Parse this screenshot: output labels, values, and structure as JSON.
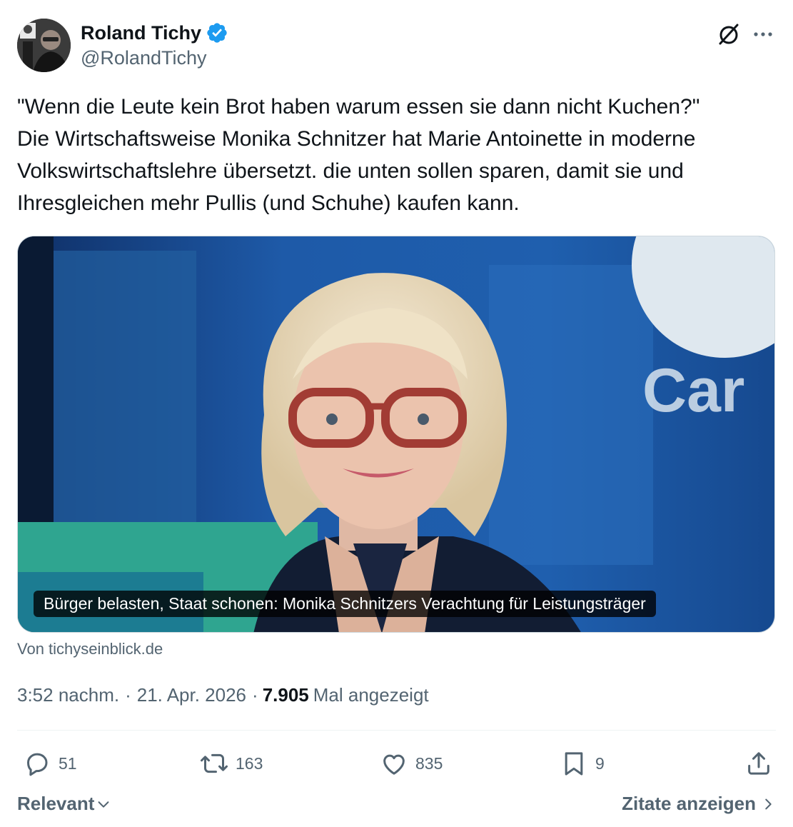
{
  "author": {
    "display_name": "Roland Tichy",
    "handle": "@RolandTichy",
    "verified": true
  },
  "tweet": {
    "text": "\"Wenn die Leute kein Brot haben warum essen sie dann nicht Kuchen?\"\nDie Wirtschaftsweise Monika Schnitzer hat Marie Antoinette in moderne Volkswirtschaftslehre übersetzt. die unten sollen sparen, damit sie und Ihresgleichen mehr Pullis (und Schuhe) kaufen kann."
  },
  "card": {
    "caption": "Bürger belasten, Staat schonen: Monika Schnitzers Verachtung für Leistungsträger",
    "source": "Von tichyseinblick.de",
    "watermark_text": "Car"
  },
  "meta": {
    "time": "3:52 nachm.",
    "separator": "·",
    "date": "21. Apr. 2026",
    "views": "7.905",
    "views_label": "Mal angezeigt"
  },
  "actions": {
    "replies": "51",
    "reposts": "163",
    "likes": "835",
    "bookmarks": "9"
  },
  "footer": {
    "sort_label": "Relevant",
    "quotes_label": "Zitate anzeigen"
  },
  "colors": {
    "accent": "#1d9bf0",
    "text": "#0f1419",
    "secondary": "#536471"
  },
  "icons": [
    "verified-badge-icon",
    "grok-icon",
    "more-icon",
    "reply-icon",
    "repost-icon",
    "like-icon",
    "bookmark-icon",
    "share-icon",
    "chevron-down-icon",
    "chevron-right-icon"
  ]
}
